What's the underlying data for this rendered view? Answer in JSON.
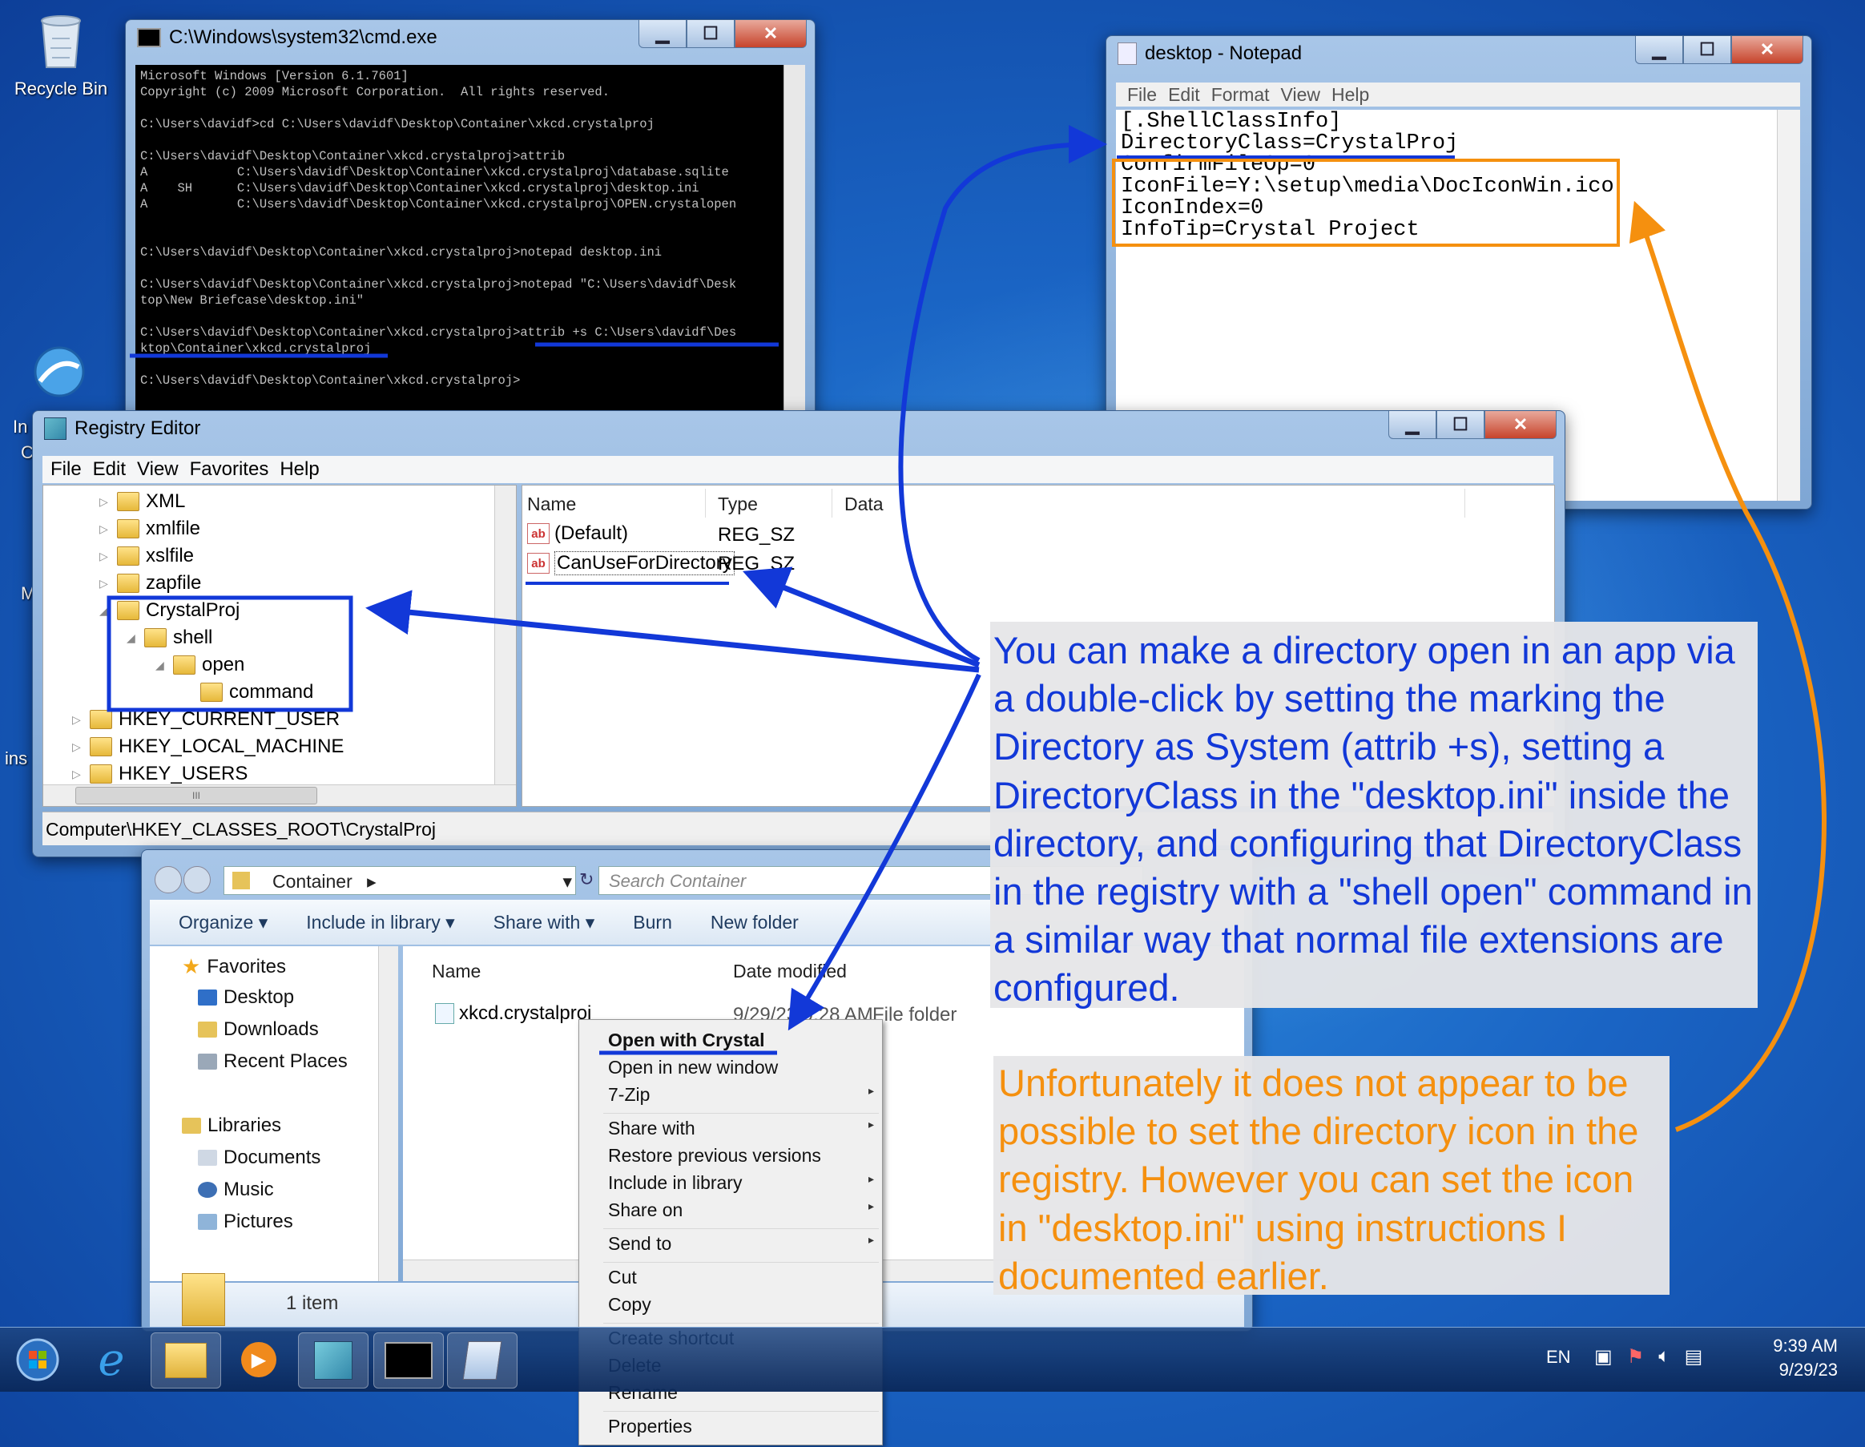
{
  "desktop": {
    "icons": [
      {
        "label": "Recycle Bin",
        "icon": "recycle-bin-icon"
      },
      {
        "label": "In",
        "icon": "internet-connection-icon"
      }
    ],
    "partial_labels": [
      "C",
      "M",
      "ins"
    ]
  },
  "cmd": {
    "title": "C:\\Windows\\system32\\cmd.exe",
    "lines": [
      "Microsoft Windows [Version 6.1.7601]",
      "Copyright (c) 2009 Microsoft Corporation.  All rights reserved.",
      "",
      "C:\\Users\\davidf>cd C:\\Users\\davidf\\Desktop\\Container\\xkcd.crystalproj",
      "",
      "C:\\Users\\davidf\\Desktop\\Container\\xkcd.crystalproj>attrib",
      "A            C:\\Users\\davidf\\Desktop\\Container\\xkcd.crystalproj\\database.sqlite",
      "A    SH      C:\\Users\\davidf\\Desktop\\Container\\xkcd.crystalproj\\desktop.ini",
      "A            C:\\Users\\davidf\\Desktop\\Container\\xkcd.crystalproj\\OPEN.crystalopen",
      "",
      "",
      "C:\\Users\\davidf\\Desktop\\Container\\xkcd.crystalproj>notepad desktop.ini",
      "",
      "C:\\Users\\davidf\\Desktop\\Container\\xkcd.crystalproj>notepad \"C:\\Users\\davidf\\Desk",
      "top\\New Briefcase\\desktop.ini\"",
      "",
      "C:\\Users\\davidf\\Desktop\\Container\\xkcd.crystalproj>attrib +s C:\\Users\\davidf\\Des",
      "ktop\\Container\\xkcd.crystalproj",
      "",
      "C:\\Users\\davidf\\Desktop\\Container\\xkcd.crystalproj>"
    ]
  },
  "notepad": {
    "title": "desktop - Notepad",
    "menu": [
      "File",
      "Edit",
      "Format",
      "View",
      "Help"
    ],
    "lines": [
      "[.ShellClassInfo]",
      "DirectoryClass=CrystalProj",
      "ConfirmFileOp=0",
      "IconFile=Y:\\setup\\media\\DocIconWin.ico",
      "IconIndex=0",
      "InfoTip=Crystal Project"
    ]
  },
  "regedit": {
    "title": "Registry Editor",
    "menu": [
      "File",
      "Edit",
      "View",
      "Favorites",
      "Help"
    ],
    "tree": [
      {
        "label": "XML",
        "indent": 2
      },
      {
        "label": "xmlfile",
        "indent": 2
      },
      {
        "label": "xslfile",
        "indent": 2
      },
      {
        "label": "zapfile",
        "indent": 2
      },
      {
        "label": "CrystalProj",
        "indent": 2
      },
      {
        "label": "shell",
        "indent": 3
      },
      {
        "label": "open",
        "indent": 4
      },
      {
        "label": "command",
        "indent": 5
      },
      {
        "label": "HKEY_CURRENT_USER",
        "indent": 1
      },
      {
        "label": "HKEY_LOCAL_MACHINE",
        "indent": 1
      },
      {
        "label": "HKEY_USERS",
        "indent": 1
      }
    ],
    "columns": [
      "Name",
      "Type",
      "Data"
    ],
    "values": [
      {
        "name": "(Default)",
        "type": "REG_SZ",
        "data": ""
      },
      {
        "name": "CanUseForDirectory",
        "type": "REG_SZ",
        "data": ""
      }
    ],
    "status": "Computer\\HKEY_CLASSES_ROOT\\CrystalProj",
    "hscroll_thumb": "III"
  },
  "explorer": {
    "breadcrumb": "Container",
    "search_placeholder": "Search Container",
    "toolbar": [
      "Organize",
      "Include in library",
      "Share with",
      "Burn",
      "New folder"
    ],
    "nav": {
      "favorites": [
        "Favorites",
        "Desktop",
        "Downloads",
        "Recent Places"
      ],
      "libraries": [
        "Libraries",
        "Documents",
        "Music",
        "Pictures"
      ]
    },
    "columns": [
      "Name",
      "Date modified"
    ],
    "rows": [
      {
        "name": "xkcd.crystalproj",
        "date": "9/29/23 9:28 AM",
        "type": "File folder"
      }
    ],
    "item_count": "1 item"
  },
  "context_menu": {
    "groups": [
      [
        {
          "label": "Open with Crystal",
          "bold": true,
          "sub": false
        },
        {
          "label": "Open in new window",
          "sub": false
        },
        {
          "label": "7-Zip",
          "sub": true
        }
      ],
      [
        {
          "label": "Share with",
          "sub": true
        },
        {
          "label": "Restore previous versions",
          "sub": false
        },
        {
          "label": "Include in library",
          "sub": true
        },
        {
          "label": "Share on",
          "sub": true
        }
      ],
      [
        {
          "label": "Send to",
          "sub": true
        }
      ],
      [
        {
          "label": "Cut",
          "sub": false
        },
        {
          "label": "Copy",
          "sub": false
        }
      ],
      [
        {
          "label": "Create shortcut",
          "sub": false
        },
        {
          "label": "Delete",
          "sub": false
        },
        {
          "label": "Rename",
          "sub": false
        }
      ],
      [
        {
          "label": "Properties",
          "sub": false
        }
      ]
    ]
  },
  "taskbar": {
    "apps": [
      "start-orb-icon",
      "internet-explorer-icon",
      "explorer-icon",
      "media-player-icon",
      "registry-editor-icon",
      "cmd-icon",
      "notepad-icon"
    ],
    "language": "EN",
    "time": "9:39 AM",
    "date": "9/29/23"
  },
  "annotations": {
    "blue_text": "You can make a directory open in an app via a double-click by setting the marking the Directory as System (attrib +s), setting a DirectoryClass in the \"desktop.ini\" inside the directory, and configuring that DirectoryClass in the registry with a \"shell open\" command in a similar way that normal file extensions are configured.",
    "orange_text": "Unfortunately it does not appear to be possible to set the directory icon in the registry. However you can set the icon in \"desktop.ini\" using instructions I documented earlier.",
    "blue_color": "#1238d8",
    "orange_color": "#f5900f"
  }
}
